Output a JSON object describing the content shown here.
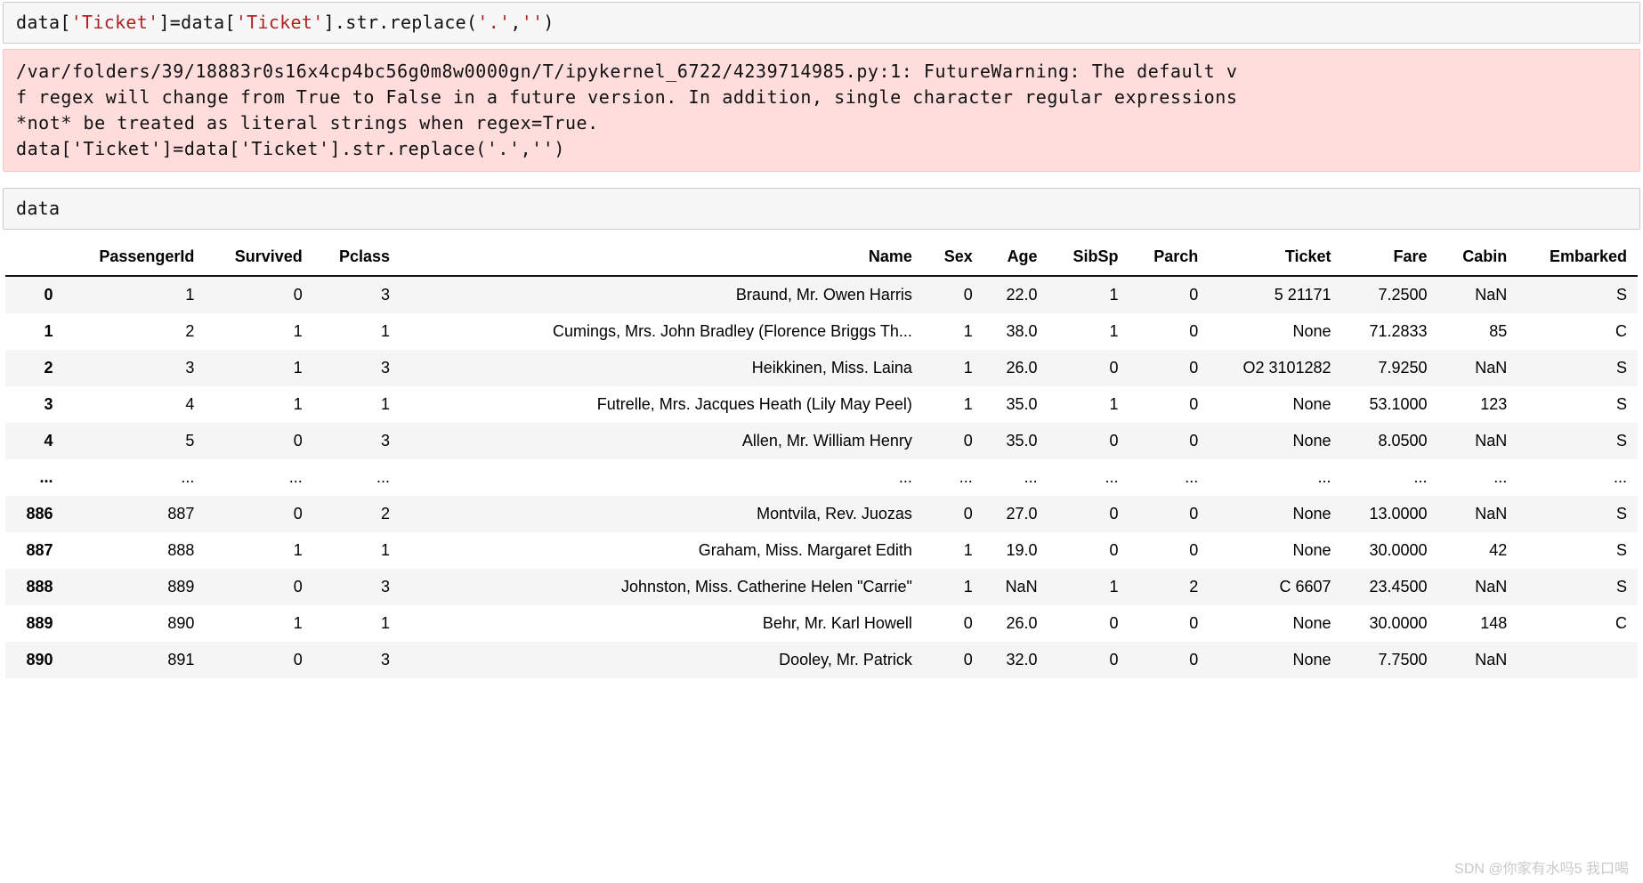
{
  "cell1": {
    "p1": "data[",
    "s1": "'Ticket'",
    "p2": "]=data[",
    "s2": "'Ticket'",
    "p3": "].str.replace(",
    "s3": "'.'",
    "p4": ",",
    "s4": "''",
    "p5": ")"
  },
  "stderr": {
    "line1": "/var/folders/39/18883r0s16x4cp4bc56g0m8w0000gn/T/ipykernel_6722/4239714985.py:1: FutureWarning: The default v",
    "line2": "f regex will change from True to False in a future version. In addition, single character regular expressions",
    "line3": "*not* be treated as literal strings when regex=True.",
    "line4": "  data['Ticket']=data['Ticket'].str.replace('.','')"
  },
  "cell2": {
    "code": "data"
  },
  "table": {
    "columns": [
      "",
      "PassengerId",
      "Survived",
      "Pclass",
      "Name",
      "Sex",
      "Age",
      "SibSp",
      "Parch",
      "Ticket",
      "Fare",
      "Cabin",
      "Embarked"
    ],
    "rows": [
      {
        "idx": "0",
        "PassengerId": "1",
        "Survived": "0",
        "Pclass": "3",
        "Name": "Braund, Mr. Owen Harris",
        "Sex": "0",
        "Age": "22.0",
        "SibSp": "1",
        "Parch": "0",
        "Ticket": "5 21171",
        "Fare": "7.2500",
        "Cabin": "NaN",
        "Embarked": "S"
      },
      {
        "idx": "1",
        "PassengerId": "2",
        "Survived": "1",
        "Pclass": "1",
        "Name": "Cumings, Mrs. John Bradley (Florence Briggs Th...",
        "Sex": "1",
        "Age": "38.0",
        "SibSp": "1",
        "Parch": "0",
        "Ticket": "None",
        "Fare": "71.2833",
        "Cabin": "85",
        "Embarked": "C"
      },
      {
        "idx": "2",
        "PassengerId": "3",
        "Survived": "1",
        "Pclass": "3",
        "Name": "Heikkinen, Miss. Laina",
        "Sex": "1",
        "Age": "26.0",
        "SibSp": "0",
        "Parch": "0",
        "Ticket": "O2 3101282",
        "Fare": "7.9250",
        "Cabin": "NaN",
        "Embarked": "S"
      },
      {
        "idx": "3",
        "PassengerId": "4",
        "Survived": "1",
        "Pclass": "1",
        "Name": "Futrelle, Mrs. Jacques Heath (Lily May Peel)",
        "Sex": "1",
        "Age": "35.0",
        "SibSp": "1",
        "Parch": "0",
        "Ticket": "None",
        "Fare": "53.1000",
        "Cabin": "123",
        "Embarked": "S"
      },
      {
        "idx": "4",
        "PassengerId": "5",
        "Survived": "0",
        "Pclass": "3",
        "Name": "Allen, Mr. William Henry",
        "Sex": "0",
        "Age": "35.0",
        "SibSp": "0",
        "Parch": "0",
        "Ticket": "None",
        "Fare": "8.0500",
        "Cabin": "NaN",
        "Embarked": "S"
      },
      {
        "idx": "...",
        "PassengerId": "...",
        "Survived": "...",
        "Pclass": "...",
        "Name": "...",
        "Sex": "...",
        "Age": "...",
        "SibSp": "...",
        "Parch": "...",
        "Ticket": "...",
        "Fare": "...",
        "Cabin": "...",
        "Embarked": "..."
      },
      {
        "idx": "886",
        "PassengerId": "887",
        "Survived": "0",
        "Pclass": "2",
        "Name": "Montvila, Rev. Juozas",
        "Sex": "0",
        "Age": "27.0",
        "SibSp": "0",
        "Parch": "0",
        "Ticket": "None",
        "Fare": "13.0000",
        "Cabin": "NaN",
        "Embarked": "S"
      },
      {
        "idx": "887",
        "PassengerId": "888",
        "Survived": "1",
        "Pclass": "1",
        "Name": "Graham, Miss. Margaret Edith",
        "Sex": "1",
        "Age": "19.0",
        "SibSp": "0",
        "Parch": "0",
        "Ticket": "None",
        "Fare": "30.0000",
        "Cabin": "42",
        "Embarked": "S"
      },
      {
        "idx": "888",
        "PassengerId": "889",
        "Survived": "0",
        "Pclass": "3",
        "Name": "Johnston, Miss. Catherine Helen \"Carrie\"",
        "Sex": "1",
        "Age": "NaN",
        "SibSp": "1",
        "Parch": "2",
        "Ticket": "C 6607",
        "Fare": "23.4500",
        "Cabin": "NaN",
        "Embarked": "S"
      },
      {
        "idx": "889",
        "PassengerId": "890",
        "Survived": "1",
        "Pclass": "1",
        "Name": "Behr, Mr. Karl Howell",
        "Sex": "0",
        "Age": "26.0",
        "SibSp": "0",
        "Parch": "0",
        "Ticket": "None",
        "Fare": "30.0000",
        "Cabin": "148",
        "Embarked": "C"
      },
      {
        "idx": "890",
        "PassengerId": "891",
        "Survived": "0",
        "Pclass": "3",
        "Name": "Dooley, Mr. Patrick",
        "Sex": "0",
        "Age": "32.0",
        "SibSp": "0",
        "Parch": "0",
        "Ticket": "None",
        "Fare": "7.7500",
        "Cabin": "NaN",
        "Embarked": ""
      }
    ]
  },
  "watermark": "SDN @你家有水吗5 我口喝"
}
